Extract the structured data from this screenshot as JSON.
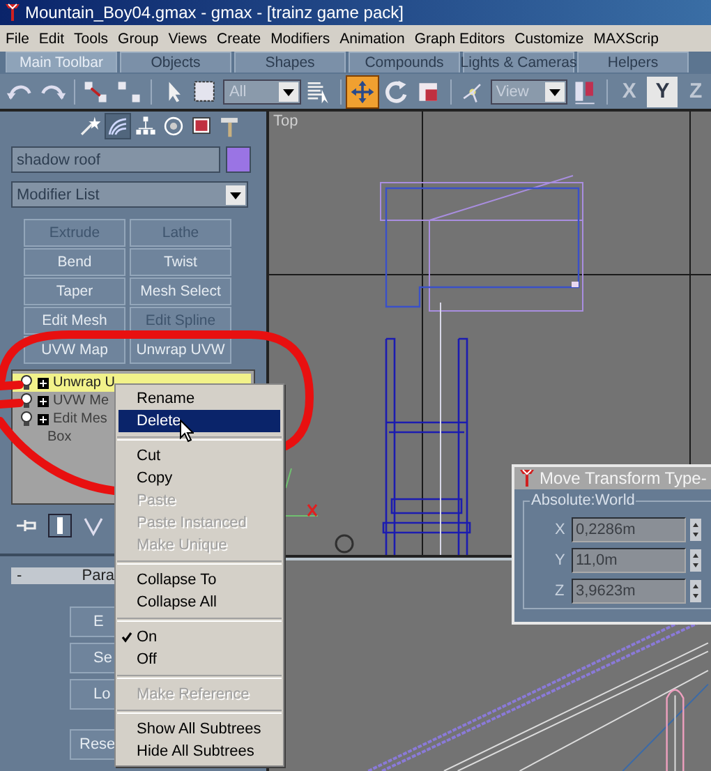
{
  "window": {
    "title": "Mountain_Boy04.gmax - gmax - [trainz game pack]"
  },
  "menu_bar": [
    "File",
    "Edit",
    "Tools",
    "Group",
    "Views",
    "Create",
    "Modifiers",
    "Animation",
    "Graph Editors",
    "Customize",
    "MAXScrip"
  ],
  "toolbar_tabs": [
    {
      "label": "Main Toolbar",
      "selected": true
    },
    {
      "label": "Objects",
      "selected": false
    },
    {
      "label": "Shapes",
      "selected": false
    },
    {
      "label": "Compounds",
      "selected": false
    },
    {
      "label": "Lights & Cameras",
      "selected": false
    },
    {
      "label": "Helpers",
      "selected": false
    }
  ],
  "toolbar": {
    "tools": [
      {
        "kind": "undo",
        "selected": false
      },
      {
        "kind": "redo",
        "selected": false
      },
      {
        "kind": "link",
        "selected": false
      },
      {
        "kind": "unlink",
        "selected": false
      },
      {
        "kind": "select",
        "selected": false
      },
      {
        "kind": "region",
        "selected": false
      },
      {
        "kind": "by-name",
        "selected": false
      },
      {
        "kind": "move",
        "selected": true
      },
      {
        "kind": "rotate",
        "selected": false
      },
      {
        "kind": "scale",
        "selected": false
      },
      {
        "kind": "pivot",
        "selected": false
      },
      {
        "kind": "align",
        "selected": false
      }
    ],
    "selection_filter": "All",
    "coordinate_system": "View",
    "axes": [
      {
        "label": "X",
        "selected": false
      },
      {
        "label": "Y",
        "selected": true
      },
      {
        "label": "Z",
        "selected": false
      }
    ]
  },
  "command_panel": {
    "tabs": [
      {
        "kind": "create",
        "selected": false
      },
      {
        "kind": "modify",
        "selected": true
      },
      {
        "kind": "hierarchy",
        "selected": false
      },
      {
        "kind": "motion",
        "selected": false
      },
      {
        "kind": "display",
        "selected": false
      },
      {
        "kind": "utilities",
        "selected": false
      }
    ],
    "object_name": "shadow roof",
    "modifier_list": "Modifier List",
    "modifier_buttons": [
      {
        "label": "Extrude",
        "disabled": true
      },
      {
        "label": "Lathe",
        "disabled": true
      },
      {
        "label": "Bend",
        "disabled": false
      },
      {
        "label": "Twist",
        "disabled": false
      },
      {
        "label": "Taper",
        "disabled": false
      },
      {
        "label": "Mesh Select",
        "disabled": false
      },
      {
        "label": "Edit Mesh",
        "disabled": false
      },
      {
        "label": "Edit Spline",
        "disabled": true
      },
      {
        "label": "UVW Map",
        "disabled": false
      },
      {
        "label": "Unwrap UVW",
        "disabled": false
      }
    ],
    "stack": [
      {
        "kind": "modifier",
        "label": "Unwrap U",
        "selected": true
      },
      {
        "kind": "modifier",
        "label": "UVW Me",
        "selected": false
      },
      {
        "kind": "modifier",
        "label": "Edit Mes",
        "selected": false
      },
      {
        "kind": "base",
        "label": "Box",
        "selected": false
      }
    ],
    "parameters": {
      "collapse_sign": "-",
      "title": "Para",
      "buttons": [
        "E",
        "Se",
        "Lo",
        "Rese"
      ]
    }
  },
  "viewports": [
    {
      "label": "Top"
    }
  ],
  "context_menu": [
    {
      "kind": "item",
      "label": "Rename",
      "selected": false,
      "disabled": false,
      "checked": false
    },
    {
      "kind": "item",
      "label": "Delete",
      "selected": true,
      "disabled": false,
      "checked": false
    },
    {
      "kind": "separator"
    },
    {
      "kind": "item",
      "label": "Cut",
      "selected": false,
      "disabled": false,
      "checked": false
    },
    {
      "kind": "item",
      "label": "Copy",
      "selected": false,
      "disabled": false,
      "checked": false
    },
    {
      "kind": "item",
      "label": "Paste",
      "selected": false,
      "disabled": true,
      "checked": false
    },
    {
      "kind": "item",
      "label": "Paste Instanced",
      "selected": false,
      "disabled": true,
      "checked": false
    },
    {
      "kind": "item",
      "label": "Make Unique",
      "selected": false,
      "disabled": true,
      "checked": false
    },
    {
      "kind": "separator"
    },
    {
      "kind": "item",
      "label": "Collapse To",
      "selected": false,
      "disabled": false,
      "checked": false
    },
    {
      "kind": "item",
      "label": "Collapse All",
      "selected": false,
      "disabled": false,
      "checked": false
    },
    {
      "kind": "separator"
    },
    {
      "kind": "item",
      "label": "On",
      "selected": false,
      "disabled": false,
      "checked": true
    },
    {
      "kind": "item",
      "label": "Off",
      "selected": false,
      "disabled": false,
      "checked": false
    },
    {
      "kind": "separator"
    },
    {
      "kind": "item",
      "label": "Make Reference",
      "selected": false,
      "disabled": true,
      "checked": false
    },
    {
      "kind": "separator"
    },
    {
      "kind": "item",
      "label": "Show All Subtrees",
      "selected": false,
      "disabled": false,
      "checked": false
    },
    {
      "kind": "item",
      "label": "Hide All Subtrees",
      "selected": false,
      "disabled": false,
      "checked": false
    }
  ],
  "transform_dialog": {
    "title": "Move Transform Type-",
    "group": "Absolute:World",
    "fields": [
      {
        "label": "X",
        "value": "0,2286m"
      },
      {
        "label": "Y",
        "value": "11,0m"
      },
      {
        "label": "Z",
        "value": "3,9623m"
      }
    ]
  }
}
